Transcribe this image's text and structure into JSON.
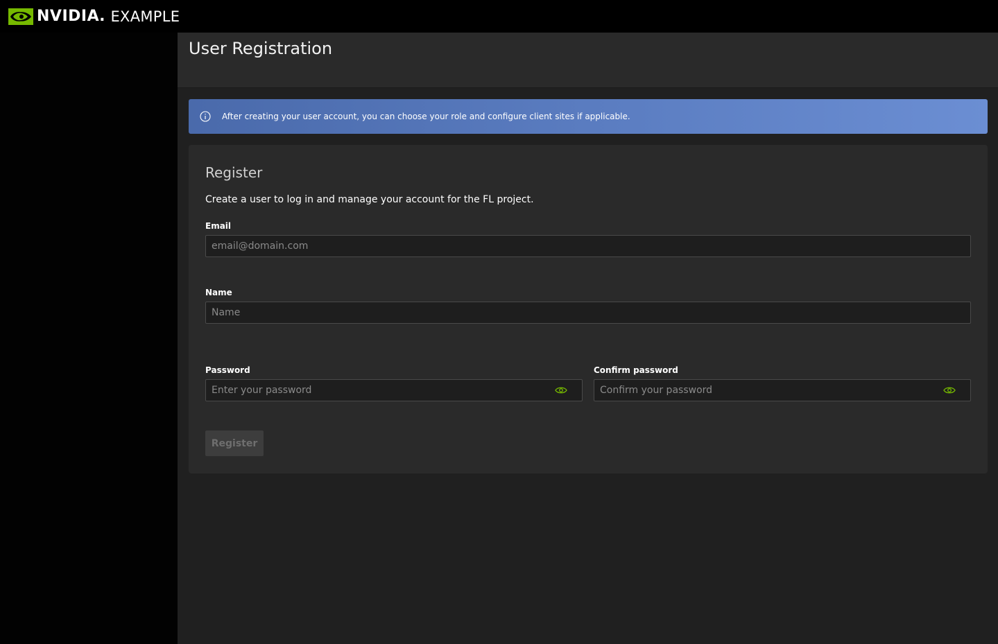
{
  "header": {
    "brand": "NVIDIA",
    "brand_dot": ".",
    "app_name": "EXAMPLE"
  },
  "page": {
    "title": "User Registration"
  },
  "banner": {
    "icon": "info-icon",
    "text": "After creating your user account, you can choose your role and configure client sites if applicable."
  },
  "register_card": {
    "title": "Register",
    "description": "Create a user to log in and manage your account for the FL project.",
    "email": {
      "label": "Email",
      "placeholder": "email@domain.com",
      "value": ""
    },
    "name": {
      "label": "Name",
      "placeholder": "Name",
      "value": ""
    },
    "password": {
      "label": "Password",
      "placeholder": "Enter your password",
      "value": "",
      "toggle_icon": "eye-icon"
    },
    "confirm_password": {
      "label": "Confirm password",
      "placeholder": "Confirm your password",
      "value": "",
      "toggle_icon": "eye-icon"
    },
    "submit_label": "Register",
    "submit_disabled": true
  },
  "colors": {
    "brand_green": "#76b900",
    "banner_start": "#4a6aab",
    "banner_end": "#6b8ed3",
    "background": "#202020",
    "card": "#2a2a2a"
  }
}
